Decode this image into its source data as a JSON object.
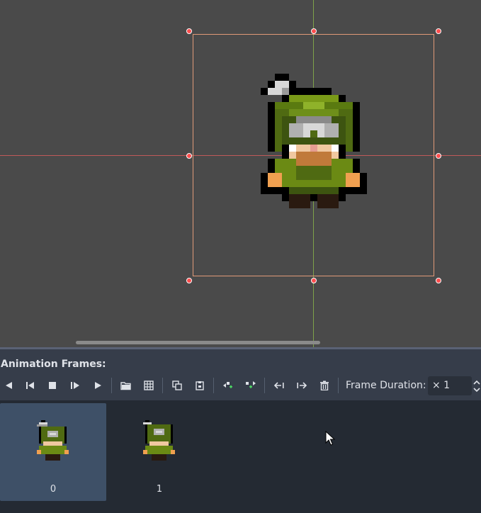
{
  "panel": {
    "title": "Animation Frames:",
    "toolbar": {
      "buttons": [
        {
          "name": "play-backwards-button",
          "icon": "play-backwards-icon"
        },
        {
          "name": "step-backward-button",
          "icon": "step-backward-icon"
        },
        {
          "name": "stop-button",
          "icon": "stop-icon"
        },
        {
          "name": "step-forward-button",
          "icon": "step-forward-icon"
        },
        {
          "name": "play-button",
          "icon": "play-icon"
        },
        {
          "name": "load-from-file-button",
          "icon": "folder-icon"
        },
        {
          "name": "add-from-sprite-sheet-button",
          "icon": "grid-icon"
        },
        {
          "name": "copy-frame-button",
          "icon": "copy-icon"
        },
        {
          "name": "paste-frame-button",
          "icon": "paste-icon"
        },
        {
          "name": "insert-empty-before-button",
          "icon": "insert-before-icon"
        },
        {
          "name": "insert-empty-after-button",
          "icon": "insert-after-icon"
        },
        {
          "name": "move-frame-left-button",
          "icon": "move-left-icon"
        },
        {
          "name": "move-frame-right-button",
          "icon": "move-right-icon"
        },
        {
          "name": "delete-frame-button",
          "icon": "trash-icon"
        }
      ],
      "frame_duration_label": "Frame Duration:",
      "frame_duration_value": "× 1"
    },
    "frames": [
      {
        "label": "0",
        "selected": true
      },
      {
        "label": "1",
        "selected": false
      }
    ]
  },
  "colors": {
    "viewport_bg": "#4a4a4a",
    "panel_bg": "#363d4a",
    "frames_bg": "#242a33",
    "selected_frame": "#3e5067",
    "bbox": "#e09a78",
    "handle": "#ff4d4d",
    "x_axis": "#c05a5a",
    "y_axis": "#7fa24a"
  }
}
